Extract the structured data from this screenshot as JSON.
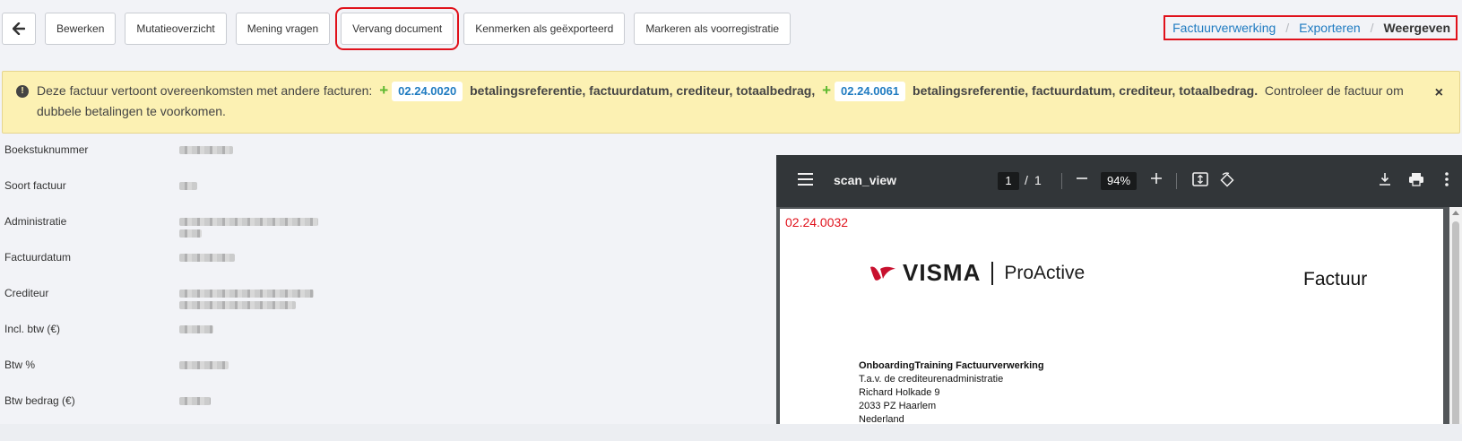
{
  "toolbar": {
    "back_label": "",
    "buttons": [
      "Bewerken",
      "Mutatieoverzicht",
      "Mening vragen",
      "Vervang document",
      "Kenmerken als geëxporteerd",
      "Markeren als voorregistratie"
    ]
  },
  "breadcrumb": {
    "items": [
      "Factuurverwerking",
      "Exporteren"
    ],
    "separator": "/",
    "current": "Weergeven"
  },
  "alert": {
    "intro": "Deze factuur vertoont overeenkomsten met andere facturen:",
    "matches": [
      {
        "ref": "02.24.0020",
        "fields": "betalingsreferentie, factuurdatum, crediteur, totaalbedrag,"
      },
      {
        "ref": "02.24.0061",
        "fields": "betalingsreferentie, factuurdatum, crediteur, totaalbedrag."
      }
    ],
    "outro": "Controleer de factuur om dubbele betalingen te voorkomen.",
    "close": "×"
  },
  "fields": [
    {
      "label": "Boekstuknummer"
    },
    {
      "label": "Soort factuur"
    },
    {
      "label": "Administratie"
    },
    {
      "label": "Factuurdatum"
    },
    {
      "label": "Crediteur"
    },
    {
      "label": "Incl. btw (€)"
    },
    {
      "label": "Btw %"
    },
    {
      "label": "Btw bedrag (€)"
    }
  ],
  "pdf": {
    "title": "scan_view",
    "page": "1",
    "page_separator": "/",
    "page_total": "1",
    "zoom": "94%",
    "page_ref": "02.24.0032",
    "logo_brand": "VISMA",
    "logo_product": "ProActive",
    "document_title": "Factuur",
    "address": {
      "name": "OnboardingTraining Factuurverwerking",
      "line1": "T.a.v. de crediteurenadministratie",
      "line2": "Richard Holkade 9",
      "line3": "2033 PZ Haarlem",
      "line4": "Nederland"
    }
  },
  "colors": {
    "accent": "#1f7bc1",
    "highlight": "#e0111b",
    "alert_bg": "#fcf1b3",
    "plus": "#5cb82e"
  }
}
